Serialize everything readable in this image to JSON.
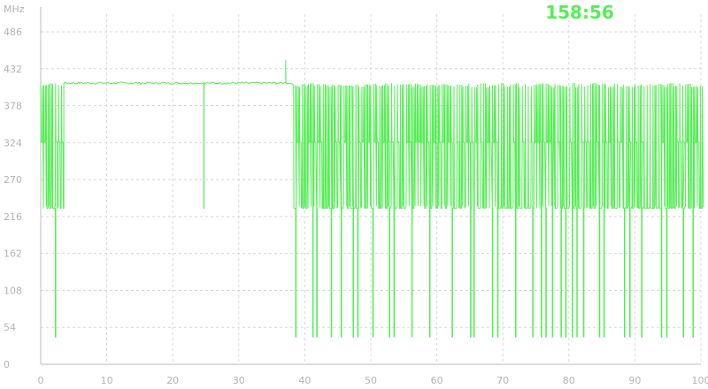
{
  "timer": "158:56",
  "chart_data": {
    "type": "line",
    "y_unit_label": "MHz",
    "x_unit_label": "%",
    "xlim": [
      0,
      100
    ],
    "ylim": [
      0,
      486
    ],
    "x_ticks": [
      0,
      10,
      20,
      30,
      40,
      50,
      60,
      70,
      80,
      90,
      100
    ],
    "y_ticks": [
      0,
      54,
      108,
      162,
      216,
      270,
      324,
      378,
      432,
      486
    ],
    "x_tick_labels": [
      "0",
      "10",
      "20",
      "30",
      "40",
      "50",
      "60",
      "70",
      "80",
      "90",
      "100"
    ],
    "y_tick_labels": [
      "0",
      "54",
      "108",
      "162",
      "216",
      "270",
      "324",
      "378",
      "432",
      "486"
    ],
    "grid": true,
    "colors": {
      "line": "#55ee55",
      "timer": "#55ee55",
      "grid": "#d8d8d8",
      "axis": "#bdbdbd",
      "ticks": "#b4b4b4"
    },
    "series": [
      {
        "segments": [
          {
            "x_start": 0,
            "x_end": 3.5,
            "pattern": "oscillate",
            "levels": [
              411,
              325,
              228
            ],
            "dips": [
              {
                "x": 2.2,
                "y": 40
              }
            ]
          },
          {
            "x_start": 3.5,
            "x_end": 38.3,
            "pattern": "steady",
            "level": 411,
            "dips": [
              {
                "x": 24.6,
                "y": 228
              }
            ],
            "spikes": [
              {
                "x": 37.0,
                "y": 445
              }
            ]
          },
          {
            "x_start": 38.3,
            "x_end": 100,
            "pattern": "oscillate",
            "levels": [
              411,
              325,
              228
            ],
            "dips": [
              {
                "x": 38.6,
                "y": 40
              },
              {
                "x": 41.2,
                "y": 40
              },
              {
                "x": 41.8,
                "y": 40
              },
              {
                "x": 44.0,
                "y": 40
              },
              {
                "x": 45.5,
                "y": 40
              },
              {
                "x": 47.3,
                "y": 40
              },
              {
                "x": 48.0,
                "y": 40
              },
              {
                "x": 50.3,
                "y": 40
              },
              {
                "x": 52.8,
                "y": 40
              },
              {
                "x": 53.5,
                "y": 40
              },
              {
                "x": 56.2,
                "y": 40
              },
              {
                "x": 58.9,
                "y": 40
              },
              {
                "x": 62.3,
                "y": 40
              },
              {
                "x": 65.1,
                "y": 40
              },
              {
                "x": 65.6,
                "y": 40
              },
              {
                "x": 68.4,
                "y": 40
              },
              {
                "x": 69.2,
                "y": 40
              },
              {
                "x": 71.9,
                "y": 40
              },
              {
                "x": 74.5,
                "y": 40
              },
              {
                "x": 75.8,
                "y": 40
              },
              {
                "x": 76.5,
                "y": 40
              },
              {
                "x": 77.5,
                "y": 40
              },
              {
                "x": 78.8,
                "y": 40
              },
              {
                "x": 79.5,
                "y": 40
              },
              {
                "x": 80.5,
                "y": 40
              },
              {
                "x": 81.2,
                "y": 40
              },
              {
                "x": 82.2,
                "y": 40
              },
              {
                "x": 84.6,
                "y": 40
              },
              {
                "x": 85.3,
                "y": 40
              },
              {
                "x": 88.4,
                "y": 40
              },
              {
                "x": 89.2,
                "y": 40
              },
              {
                "x": 91.0,
                "y": 40
              },
              {
                "x": 94.0,
                "y": 40
              },
              {
                "x": 94.8,
                "y": 40
              },
              {
                "x": 97.3,
                "y": 40
              },
              {
                "x": 98.8,
                "y": 40
              }
            ]
          }
        ]
      }
    ]
  }
}
